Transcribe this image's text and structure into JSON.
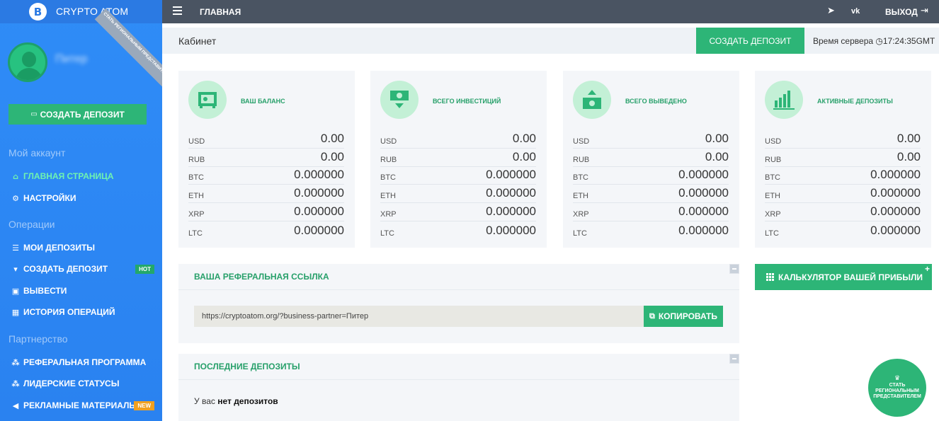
{
  "brand": {
    "name": "CRYPTO ATOM",
    "logo_letter": "B"
  },
  "ribbon": {
    "text": "СТАТЬ РЕГИОНАЛЬНЫМ ПРЕДСТАВИТЕЛЕМ"
  },
  "user": {
    "name": "Питер"
  },
  "sidebar": {
    "create_btn": "СОЗДАТЬ ДЕПОЗИТ",
    "sections": [
      "Мой аккаунт",
      "Операции",
      "Партнерство"
    ],
    "items": [
      {
        "label": "ГЛАВНАЯ СТРАНИЦА",
        "icon": "home-icon"
      },
      {
        "label": "НАСТРОЙКИ",
        "icon": "gear-icon"
      },
      {
        "label": "МОИ ДЕПОЗИТЫ",
        "icon": "list-icon"
      },
      {
        "label": "СОЗДАТЬ ДЕПОЗИТ",
        "icon": "download-icon",
        "badge": "HOT"
      },
      {
        "label": "ВЫВЕСТИ",
        "icon": "briefcase-icon"
      },
      {
        "label": "ИСТОРИЯ ОПЕРАЦИЙ",
        "icon": "table-icon"
      },
      {
        "label": "РЕФЕРАЛЬНАЯ ПРОГРАММА",
        "icon": "sitemap-icon"
      },
      {
        "label": "ЛИДЕРСКИЕ СТАТУСЫ",
        "icon": "sitemap-icon"
      },
      {
        "label": "РЕКЛАМНЫЕ МАТЕРИАЛЫ",
        "icon": "bullhorn-icon",
        "badge": "NEW"
      }
    ]
  },
  "topbar": {
    "home": "ГЛАВНАЯ",
    "exit": "ВЫХОД"
  },
  "subhead": {
    "title": "Кабинет",
    "create_btn": "СОЗДАТЬ ДЕПОЗИТ",
    "server_time_label": "Время сервера",
    "server_time": "17:24:35GMT"
  },
  "cards": [
    {
      "title": "ВАШ БАЛАНС",
      "icon": "safe-icon",
      "rows": [
        [
          "USD",
          "0.00"
        ],
        [
          "RUB",
          "0.00"
        ],
        [
          "BTC",
          "0.000000"
        ],
        [
          "ETH",
          "0.000000"
        ],
        [
          "XRP",
          "0.000000"
        ],
        [
          "LTC",
          "0.000000"
        ]
      ]
    },
    {
      "title": "ВСЕГО ИНВЕСТИЦИЙ",
      "icon": "money-in-icon",
      "rows": [
        [
          "USD",
          "0.00"
        ],
        [
          "RUB",
          "0.00"
        ],
        [
          "BTC",
          "0.000000"
        ],
        [
          "ETH",
          "0.000000"
        ],
        [
          "XRP",
          "0.000000"
        ],
        [
          "LTC",
          "0.000000"
        ]
      ]
    },
    {
      "title": "ВСЕГО ВЫВЕДЕНО",
      "icon": "money-out-icon",
      "rows": [
        [
          "USD",
          "0.00"
        ],
        [
          "RUB",
          "0.00"
        ],
        [
          "BTC",
          "0.000000"
        ],
        [
          "ETH",
          "0.000000"
        ],
        [
          "XRP",
          "0.000000"
        ],
        [
          "LTC",
          "0.000000"
        ]
      ]
    },
    {
      "title": "АКТИВНЫЕ ДЕПОЗИТЫ",
      "icon": "bar-chart-icon",
      "rows": [
        [
          "USD",
          "0.00"
        ],
        [
          "RUB",
          "0.00"
        ],
        [
          "BTC",
          "0.000000"
        ],
        [
          "ETH",
          "0.000000"
        ],
        [
          "XRP",
          "0.000000"
        ],
        [
          "LTC",
          "0.000000"
        ]
      ]
    }
  ],
  "referral": {
    "title": "ВАША РЕФЕРАЛЬНАЯ ССЫЛКА",
    "link": "https://cryptoatom.org/?business-partner=Питер",
    "copy_btn": "КОПИРОВАТЬ"
  },
  "deposits": {
    "title": "ПОСЛЕДНИЕ ДЕПОЗИТЫ",
    "empty_prefix": "У вас",
    "empty_bold": "нет депозитов"
  },
  "calculator": {
    "label": "КАЛЬКУЛЯТОР ВАШЕЙ ПРИБЫЛИ"
  },
  "region_btn": {
    "text": "СТАТЬ РЕГИОНАЛЬНЫМ ПРЕДСТАВИТЕЛЕМ"
  },
  "colors": {
    "accent": "#2db577",
    "sidebar": "#2f8cf7",
    "topbar": "#4a5462"
  }
}
